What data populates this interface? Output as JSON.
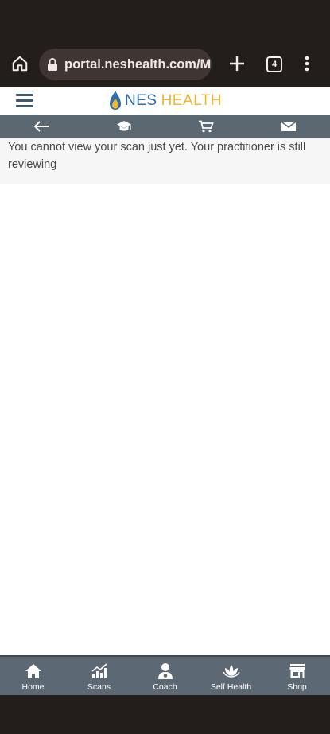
{
  "browser": {
    "url": "portal.neshealth.com/My",
    "tab_count": "4"
  },
  "site": {
    "logo_nes": "NES",
    "logo_health": "HEALTH"
  },
  "nav_strip": {
    "icons": [
      "back-arrow-icon",
      "graduation-cap-icon",
      "cart-icon",
      "mail-icon"
    ]
  },
  "message": "You cannot view your scan just yet. Your practitioner is still reviewing",
  "tabbar": {
    "items": [
      {
        "label": "Home",
        "icon": "home-icon"
      },
      {
        "label": "Scans",
        "icon": "bar-chart-icon"
      },
      {
        "label": "Coach",
        "icon": "coach-icon"
      },
      {
        "label": "Self Health",
        "icon": "lotus-icon"
      },
      {
        "label": "Shop",
        "icon": "store-icon"
      }
    ]
  },
  "colors": {
    "nav_strip": "#5b6872",
    "tabbar": "#5c6873",
    "logo_blue": "#2f6ea8",
    "logo_gold": "#f2b731"
  }
}
